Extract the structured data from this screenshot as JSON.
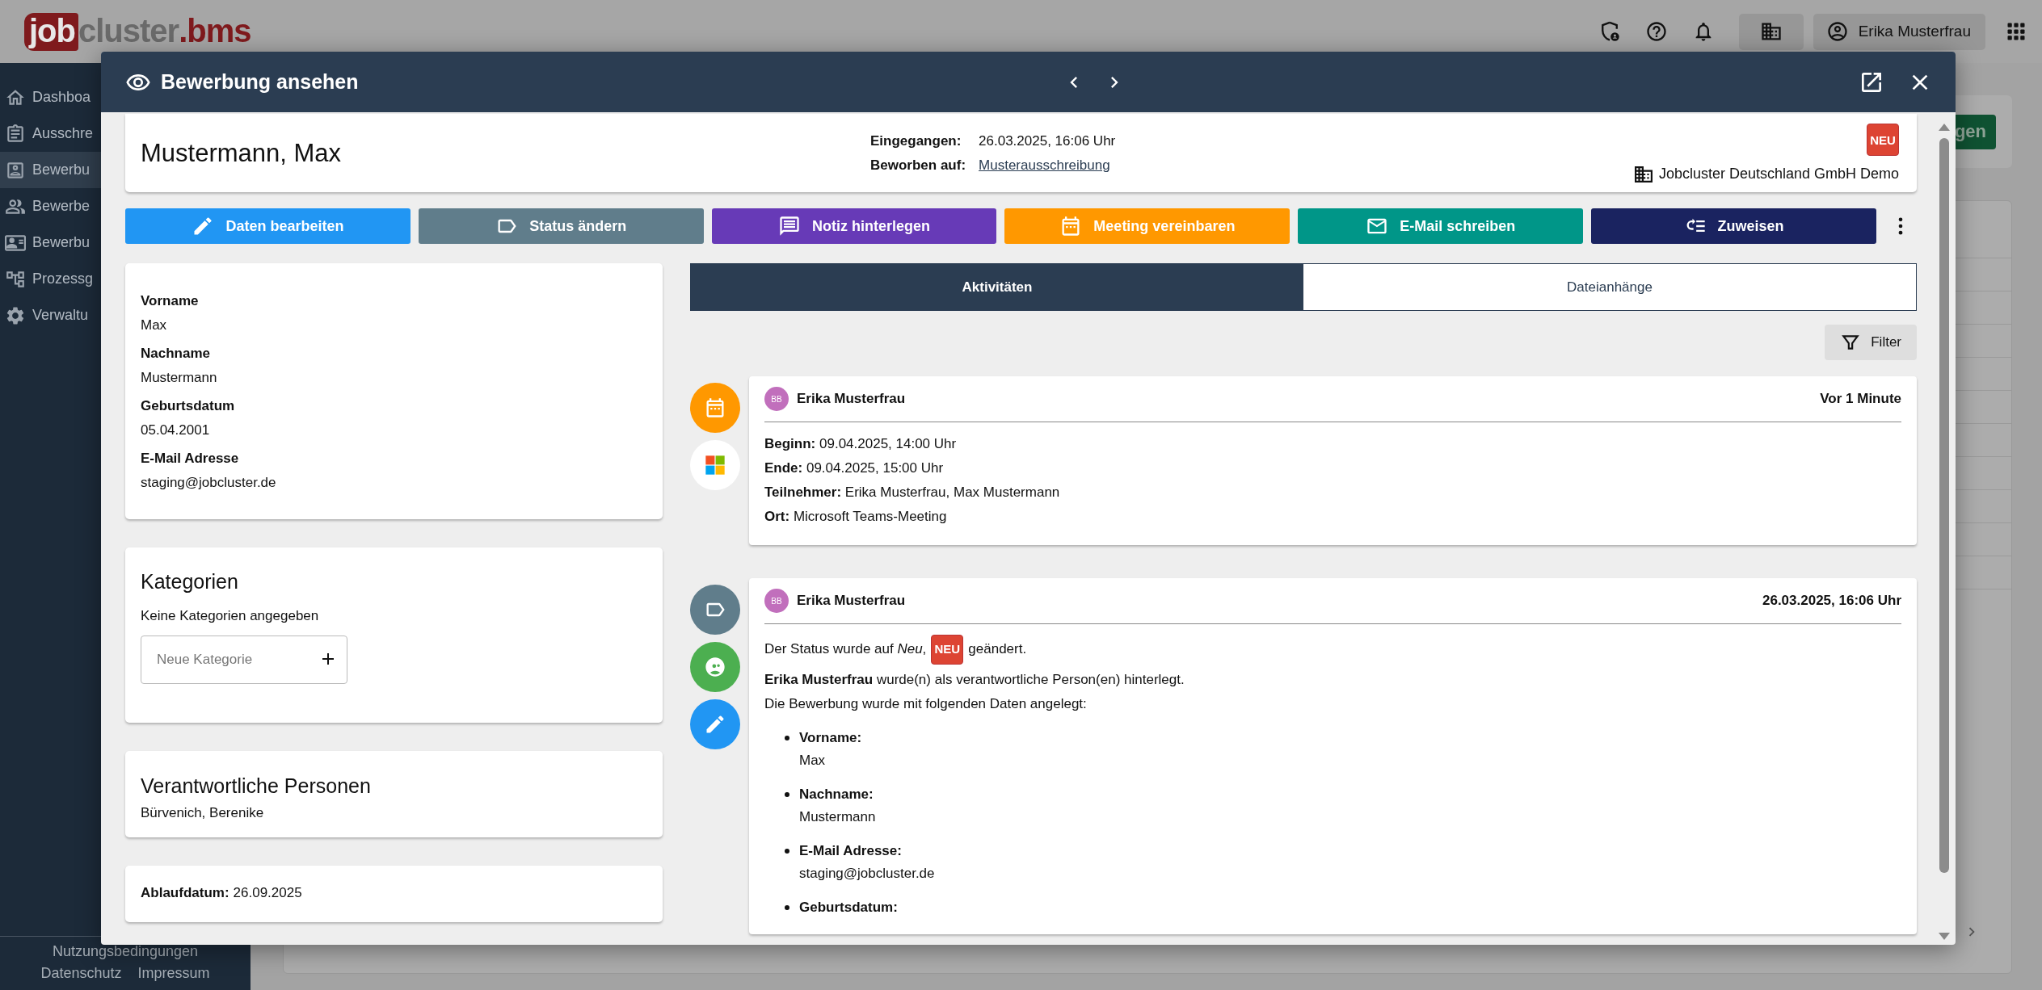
{
  "app": {
    "logo": {
      "prefix": "job",
      "name": "cluster",
      "suffix": ".bms"
    },
    "top_bar": {
      "user_name": "Erika Musterfrau"
    },
    "sidebar": {
      "items": [
        {
          "label": "Dashboa",
          "kind": "home",
          "selected": false
        },
        {
          "label": "Ausschre",
          "kind": "clipboard",
          "selected": false
        },
        {
          "label": "Bewerbu",
          "kind": "person-box",
          "selected": true
        },
        {
          "label": "Bewerbe",
          "kind": "people",
          "selected": false
        },
        {
          "label": "Bewerbu",
          "kind": "contact-card",
          "selected": false
        },
        {
          "label": "Prozessg",
          "kind": "tree",
          "selected": false
        },
        {
          "label": "Verwaltu",
          "kind": "gear",
          "selected": false
        }
      ],
      "footer_links": [
        "Nutzungsbedingungen",
        "Datenschutz",
        "Impressum"
      ]
    },
    "background_button": "gen"
  },
  "dialog": {
    "title": "Bewerbung ansehen",
    "applicant": {
      "name": "Mustermann, Max",
      "meta": [
        {
          "label": "Eingegangen:",
          "value": "26.03.2025, 16:06 Uhr",
          "kind": "text"
        },
        {
          "label": "Beworben auf:",
          "value": "Musterausschreibung",
          "kind": "link"
        }
      ],
      "status_badge": "NEU",
      "company": "Jobcluster Deutschland GmbH Demo"
    },
    "actions": [
      {
        "label": "Daten bearbeiten",
        "kind": "edit",
        "color": "#2196f3"
      },
      {
        "label": "Status ändern",
        "kind": "status",
        "color": "#607d8b"
      },
      {
        "label": "Notiz hinterlegen",
        "kind": "note",
        "color": "#673ab7"
      },
      {
        "label": "Meeting vereinbaren",
        "kind": "meeting",
        "color": "#ff9800"
      },
      {
        "label": "E-Mail schreiben",
        "kind": "email",
        "color": "#009688"
      },
      {
        "label": "Zuweisen",
        "kind": "assign",
        "color": "#1a2360"
      }
    ],
    "details": [
      {
        "label": "Vorname",
        "value": "Max"
      },
      {
        "label": "Nachname",
        "value": "Mustermann"
      },
      {
        "label": "Geburtsdatum",
        "value": "05.04.2001"
      },
      {
        "label": "E-Mail Adresse",
        "value": "staging@jobcluster.de"
      }
    ],
    "categories": {
      "title": "Kategorien",
      "empty_text": "Keine Kategorien angegeben",
      "input": {
        "placeholder": "Neue Kategorie"
      }
    },
    "responsible": {
      "title": "Verantwortliche Personen",
      "value": "Bürvenich, Berenike"
    },
    "expiry": {
      "label": "Ablaufdatum:",
      "value": "26.09.2025"
    },
    "tabs": [
      {
        "label": "Aktivitäten",
        "selected": true
      },
      {
        "label": "Dateianhänge",
        "selected": false
      }
    ],
    "filter_button": "Filter",
    "activities": [
      {
        "markers": [
          {
            "kind": "meeting",
            "color": "#ff9800"
          },
          {
            "kind": "microsoft",
            "color": "#ffffff"
          }
        ],
        "avatar": "BB",
        "author": "Erika Musterfrau",
        "time": "Vor 1 Minute",
        "body": [
          {
            "kind": "text",
            "text": "**Beginn:** 09.04.2025, 14:00 Uhr"
          },
          {
            "kind": "text",
            "text": "**Ende:** 09.04.2025, 15:00 Uhr"
          },
          {
            "kind": "text",
            "text": "**Teilnehmer:** Erika Musterfrau, Max Mustermann"
          },
          {
            "kind": "text",
            "text": "**Ort:** Microsoft Teams-Meeting"
          }
        ]
      },
      {
        "markers": [
          {
            "kind": "status",
            "color": "#607d8b"
          },
          {
            "kind": "assign-person",
            "color": "#4caf50"
          },
          {
            "kind": "edit",
            "color": "#2196f3"
          }
        ],
        "avatar": "BB",
        "author": "Erika Musterfrau",
        "time": "26.03.2025, 16:06 Uhr",
        "body": [
          {
            "kind": "status",
            "before": "Der Status wurde auf *Neu*,",
            "badge": "NEU",
            "after": "geändert."
          },
          {
            "kind": "text",
            "text": "**Erika Musterfrau** wurde(n) als verantwortliche Person(en) hinterlegt."
          },
          {
            "kind": "text",
            "text": "Die Bewerbung wurde mit folgenden Daten angelegt:"
          },
          {
            "kind": "list",
            "items": [
              {
                "label": "Vorname:",
                "value": "Max"
              },
              {
                "label": "Nachname:",
                "value": "Mustermann"
              },
              {
                "label": "E-Mail Adresse:",
                "value": "staging@jobcluster.de"
              },
              {
                "label": "Geburtsdatum:"
              }
            ]
          }
        ]
      }
    ]
  }
}
